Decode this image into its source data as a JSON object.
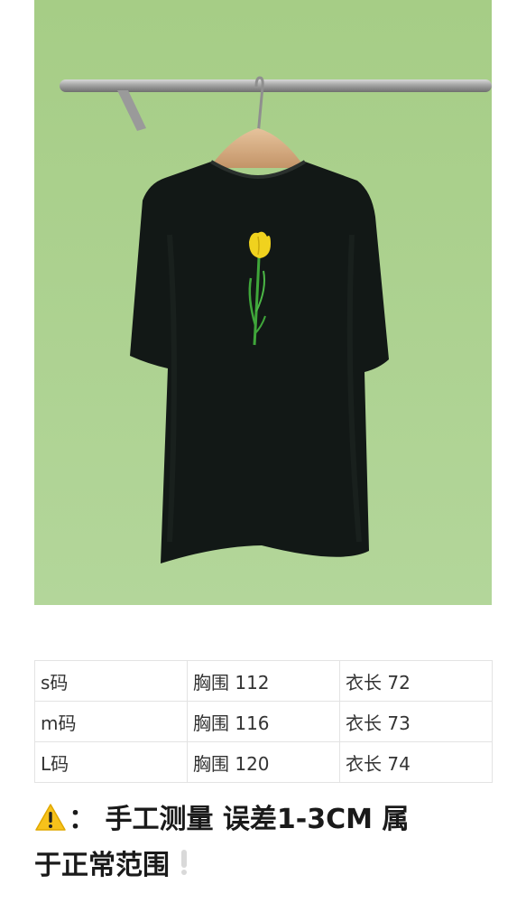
{
  "photo": {
    "subject": "black t-shirt with yellow tulip print on wooden hanger",
    "colors": {
      "background": "#a9cf8a",
      "shirt": "#121816",
      "flower": "#f0d21e",
      "stem": "#3fa63a",
      "hanger": "#d6b08a",
      "rail": "#a8a8a8"
    }
  },
  "size_table": {
    "rows": [
      [
        "s码",
        "胸围 112",
        "衣长 72"
      ],
      [
        "m码",
        "胸围 116",
        "衣长 73"
      ],
      [
        "L码",
        "胸围 120",
        "衣长 74"
      ]
    ]
  },
  "note": {
    "icon": "warning-icon",
    "text_line1": "： 手工测量 误差1-3CM 属",
    "text_line2": "于正常范围",
    "trailing_icon": "exclamation-icon"
  }
}
